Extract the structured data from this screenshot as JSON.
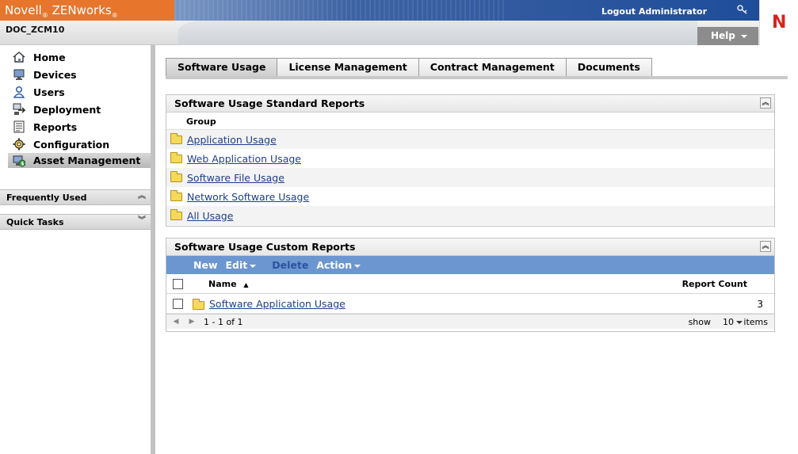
{
  "header": {
    "brand": "Novell",
    "brand_mark": "®",
    "product": "ZENworks",
    "product_mark": "®",
    "logout_label": "Logout Administrator",
    "server_name": "DOC_ZCM10",
    "help_label": "Help",
    "logo_letter": "N"
  },
  "sidebar": {
    "items": [
      {
        "label": "Home",
        "icon": "home-icon"
      },
      {
        "label": "Devices",
        "icon": "devices-icon"
      },
      {
        "label": "Users",
        "icon": "users-icon"
      },
      {
        "label": "Deployment",
        "icon": "deployment-icon"
      },
      {
        "label": "Reports",
        "icon": "reports-icon"
      },
      {
        "label": "Configuration",
        "icon": "configuration-icon"
      },
      {
        "label": "Asset Management",
        "icon": "asset-management-icon"
      }
    ],
    "sections": [
      {
        "label": "Frequently Used"
      },
      {
        "label": "Quick Tasks"
      }
    ]
  },
  "tabs": [
    {
      "label": "Software Usage"
    },
    {
      "label": "License Management"
    },
    {
      "label": "Contract Management"
    },
    {
      "label": "Documents"
    }
  ],
  "standard_reports": {
    "title": "Software Usage Standard Reports",
    "column": "Group",
    "rows": [
      "Application Usage",
      "Web Application Usage",
      "Software File Usage",
      "Network Software Usage",
      "All Usage"
    ]
  },
  "custom_reports": {
    "title": "Software Usage Custom Reports",
    "toolbar": {
      "new": "New",
      "edit": "Edit",
      "delete": "Delete",
      "action": "Action"
    },
    "columns": {
      "name": "Name",
      "sort_glyph": "▲",
      "count": "Report Count"
    },
    "rows": [
      {
        "name": "Software Application Usage",
        "count": "3"
      }
    ],
    "pager": {
      "range": "1 - 1 of 1",
      "show_label": "show",
      "page_size": "10",
      "items_label": "items"
    }
  },
  "colors": {
    "brand_orange": "#e7762c",
    "banner_blue": "#1e4d9a",
    "toolbar_blue": "#6c96cf",
    "link_blue": "#1f3e8a",
    "logo_red": "#d8221b"
  }
}
